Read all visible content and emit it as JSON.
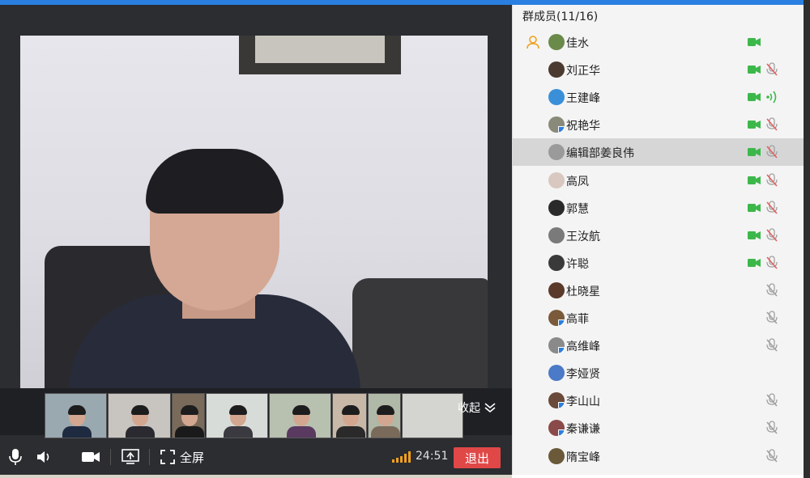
{
  "colors": {
    "accent": "#2a7fe0",
    "video_on": "#3cb84a",
    "mic_muted": "#e06060",
    "mic_muted_gray": "#a0a0a0",
    "exit": "#e04848",
    "signal": "#f0a020"
  },
  "panel": {
    "title": "群成员(11/16)"
  },
  "members": [
    {
      "name": "佳水",
      "host": true,
      "video": true,
      "mic": "none",
      "avatar_color": "#6a8a4a",
      "badge": false,
      "selected": false
    },
    {
      "name": "刘正华",
      "host": false,
      "video": true,
      "mic": "muted",
      "avatar_color": "#4a3a30",
      "badge": false,
      "selected": false
    },
    {
      "name": "王建峰",
      "host": false,
      "video": true,
      "mic": "speaking",
      "avatar_color": "#3a90d8",
      "badge": false,
      "selected": false
    },
    {
      "name": "祝艳华",
      "host": false,
      "video": true,
      "mic": "muted",
      "avatar_color": "#8a8a7a",
      "badge": true,
      "selected": false
    },
    {
      "name": "编辑部姜良伟",
      "host": false,
      "video": true,
      "mic": "muted",
      "avatar_color": "#9a9a9a",
      "badge": false,
      "selected": true
    },
    {
      "name": "高凤",
      "host": false,
      "video": true,
      "mic": "muted",
      "avatar_color": "#d8c8c0",
      "badge": false,
      "selected": false
    },
    {
      "name": "郭慧",
      "host": false,
      "video": true,
      "mic": "muted",
      "avatar_color": "#2a2a2a",
      "badge": false,
      "selected": false
    },
    {
      "name": "王汝航",
      "host": false,
      "video": true,
      "mic": "muted",
      "avatar_color": "#7a7a7a",
      "badge": false,
      "selected": false
    },
    {
      "name": "许聪",
      "host": false,
      "video": true,
      "mic": "muted",
      "avatar_color": "#3a3a3a",
      "badge": false,
      "selected": false
    },
    {
      "name": "杜晓星",
      "host": false,
      "video": false,
      "mic": "muted",
      "avatar_color": "#5a3a2a",
      "badge": false,
      "selected": false
    },
    {
      "name": "高菲",
      "host": false,
      "video": false,
      "mic": "muted",
      "avatar_color": "#7a5a3a",
      "badge": true,
      "selected": false
    },
    {
      "name": "高维峰",
      "host": false,
      "video": false,
      "mic": "muted",
      "avatar_color": "#8a8a8a",
      "badge": true,
      "selected": false
    },
    {
      "name": "李娅贤",
      "host": false,
      "video": false,
      "mic": "none",
      "avatar_color": "#4a7ac8",
      "badge": false,
      "selected": false
    },
    {
      "name": "李山山",
      "host": false,
      "video": false,
      "mic": "muted",
      "avatar_color": "#6a4a3a",
      "badge": true,
      "selected": false
    },
    {
      "name": "秦谦谦",
      "host": false,
      "video": false,
      "mic": "muted",
      "avatar_color": "#8a4a4a",
      "badge": true,
      "selected": false
    },
    {
      "name": "隋宝峰",
      "host": false,
      "video": false,
      "mic": "muted",
      "avatar_color": "#6a5a3a",
      "badge": false,
      "selected": false
    }
  ],
  "thumbnails": [
    {
      "bg": "#9aa8b0",
      "torso": "#1e2a40"
    },
    {
      "bg": "#c8c4c0",
      "torso": "#2a2a30"
    },
    {
      "bg": "#7a6a5a",
      "torso": "#1a1a1a"
    },
    {
      "bg": "#d8dcd8",
      "torso": "#3a3a40"
    },
    {
      "bg": "#b8c0b0",
      "torso": "#5a3a60"
    },
    {
      "bg": "#c8b8a8",
      "torso": "#2a2a2a"
    },
    {
      "bg": "#b0b8a8",
      "torso": "#7a6a5a"
    },
    {
      "bg": "#d4d4d0",
      "torso": "#d4d4d0"
    }
  ],
  "controls": {
    "collapse_label": "收起",
    "fullscreen_label": "全屏",
    "timer": "24:51",
    "exit_label": "退出",
    "icons": [
      "mic-icon",
      "speaker-icon",
      "camera-icon",
      "screen-share-icon",
      "fullscreen-icon"
    ]
  }
}
